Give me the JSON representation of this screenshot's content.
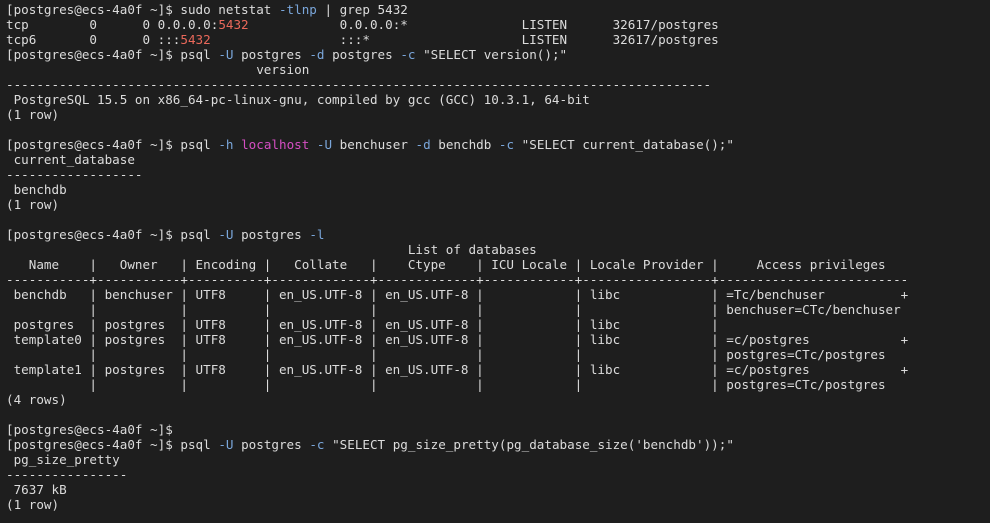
{
  "window": {
    "title": ""
  },
  "terminal": {
    "lines": [
      [
        {
          "t": "[postgres@ecs-4a0f ~]$ sudo netstat "
        },
        {
          "t": "-tlnp",
          "c": "opt"
        },
        {
          "t": " | grep 5432"
        }
      ],
      [
        {
          "t": "tcp        0      0 0.0.0.0:"
        },
        {
          "t": "5432",
          "c": "port"
        },
        {
          "t": "            0.0.0.0:*               LISTEN      32617/postgres"
        }
      ],
      [
        {
          "t": "tcp6       0      0 :::"
        },
        {
          "t": "5432",
          "c": "port"
        },
        {
          "t": "                 :::*                    LISTEN      32617/postgres"
        }
      ],
      [
        {
          "t": "[postgres@ecs-4a0f ~]$ psql "
        },
        {
          "t": "-U",
          "c": "opt"
        },
        {
          "t": " postgres "
        },
        {
          "t": "-d",
          "c": "opt"
        },
        {
          "t": " postgres "
        },
        {
          "t": "-c",
          "c": "opt"
        },
        {
          "t": " \"SELECT version();\""
        }
      ],
      [
        {
          "t": "                                 version"
        }
      ],
      [
        {
          "t": "---------------------------------------------------------------------------------------------"
        }
      ],
      [
        {
          "t": " PostgreSQL 15.5 on x86_64-pc-linux-gnu, compiled by gcc (GCC) 10.3.1, 64-bit"
        }
      ],
      [
        {
          "t": "(1 row)"
        }
      ],
      [
        {
          "t": ""
        }
      ],
      [
        {
          "t": "[postgres@ecs-4a0f ~]$ psql "
        },
        {
          "t": "-h",
          "c": "opt"
        },
        {
          "t": " "
        },
        {
          "t": "localhost",
          "c": "lh"
        },
        {
          "t": " "
        },
        {
          "t": "-U",
          "c": "opt"
        },
        {
          "t": " benchuser "
        },
        {
          "t": "-d",
          "c": "opt"
        },
        {
          "t": " benchdb "
        },
        {
          "t": "-c",
          "c": "opt"
        },
        {
          "t": " \"SELECT current_database();\""
        }
      ],
      [
        {
          "t": " current_database"
        }
      ],
      [
        {
          "t": "------------------"
        }
      ],
      [
        {
          "t": " benchdb"
        }
      ],
      [
        {
          "t": "(1 row)"
        }
      ],
      [
        {
          "t": ""
        }
      ],
      [
        {
          "t": "[postgres@ecs-4a0f ~]$ psql "
        },
        {
          "t": "-U",
          "c": "opt"
        },
        {
          "t": " postgres "
        },
        {
          "t": "-l",
          "c": "opt"
        }
      ],
      [
        {
          "t": "                                                     List of databases"
        }
      ],
      [
        {
          "t": "   Name    |   Owner   | Encoding |   Collate   |    Ctype    | ICU Locale | Locale Provider |     Access privileges"
        }
      ],
      [
        {
          "t": "-----------+-----------+----------+-------------+-------------+------------+-----------------+-------------------------"
        }
      ],
      [
        {
          "t": " benchdb   | benchuser | UTF8     | en_US.UTF-8 | en_US.UTF-8 |            | libc            | =Tc/benchuser          +"
        }
      ],
      [
        {
          "t": "           |           |          |             |             |            |                 | benchuser=CTc/benchuser"
        }
      ],
      [
        {
          "t": " postgres  | postgres  | UTF8     | en_US.UTF-8 | en_US.UTF-8 |            | libc            |"
        }
      ],
      [
        {
          "t": " template0 | postgres  | UTF8     | en_US.UTF-8 | en_US.UTF-8 |            | libc            | =c/postgres            +"
        }
      ],
      [
        {
          "t": "           |           |          |             |             |            |                 | postgres=CTc/postgres"
        }
      ],
      [
        {
          "t": " template1 | postgres  | UTF8     | en_US.UTF-8 | en_US.UTF-8 |            | libc            | =c/postgres            +"
        }
      ],
      [
        {
          "t": "           |           |          |             |             |            |                 | postgres=CTc/postgres"
        }
      ],
      [
        {
          "t": "(4 rows)"
        }
      ],
      [
        {
          "t": ""
        }
      ],
      [
        {
          "t": "[postgres@ecs-4a0f ~]$"
        }
      ],
      [
        {
          "t": "[postgres@ecs-4a0f ~]$ psql "
        },
        {
          "t": "-U",
          "c": "opt"
        },
        {
          "t": " postgres "
        },
        {
          "t": "-c",
          "c": "opt"
        },
        {
          "t": " \"SELECT pg_size_pretty(pg_database_size('benchdb'));\""
        }
      ],
      [
        {
          "t": " pg_size_pretty"
        }
      ],
      [
        {
          "t": "----------------"
        }
      ],
      [
        {
          "t": " 7637 kB"
        }
      ],
      [
        {
          "t": "(1 row)"
        }
      ]
    ]
  },
  "colors": {
    "background": "#1e1e1e",
    "text": "#dcdcdc",
    "option": "#7aa6da",
    "port": "#e9685a",
    "host": "#d54ec3"
  }
}
